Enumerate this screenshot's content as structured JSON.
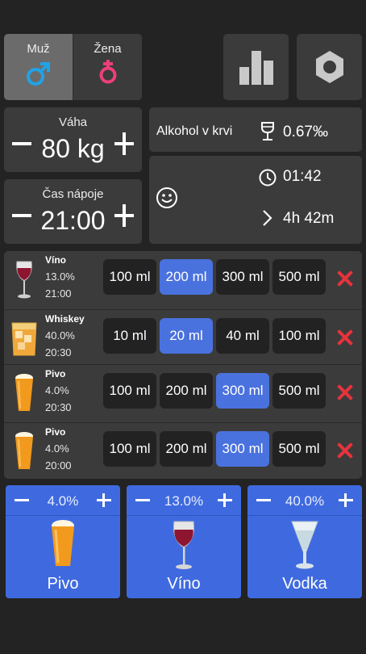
{
  "gender": {
    "male_label": "Muž",
    "female_label": "Žena",
    "selected": "male",
    "male_color": "#1fa3e8",
    "female_color": "#ec3f78"
  },
  "toolbar": {
    "stats_icon": "bar-chart-icon",
    "settings_icon": "hexagon-nut-icon"
  },
  "weight": {
    "label": "Váha",
    "value": "80 kg"
  },
  "drink_time": {
    "label": "Čas nápoje",
    "value": "21:00"
  },
  "bac": {
    "label": "Alkohol v krvi",
    "value": "0.67‰",
    "icon": "wine-glass-icon"
  },
  "status": {
    "mood_icon": "smiley-icon",
    "time_icon": "clock-icon",
    "time": "01:42",
    "remaining_icon": "chevron-right-icon",
    "remaining": "4h 42m"
  },
  "drinks": [
    {
      "name": "Víno",
      "percent": "13.0%",
      "time": "21:00",
      "icon": "wine-icon",
      "volumes": [
        "100 ml",
        "200 ml",
        "300 ml",
        "500 ml"
      ],
      "selected": 1
    },
    {
      "name": "Whiskey",
      "percent": "40.0%",
      "time": "20:30",
      "icon": "whiskey-icon",
      "volumes": [
        "10 ml",
        "20 ml",
        "40 ml",
        "100 ml"
      ],
      "selected": 1
    },
    {
      "name": "Pivo",
      "percent": "4.0%",
      "time": "20:30",
      "icon": "beer-icon",
      "volumes": [
        "100 ml",
        "200 ml",
        "300 ml",
        "500 ml"
      ],
      "selected": 2
    },
    {
      "name": "Pivo",
      "percent": "4.0%",
      "time": "20:00",
      "icon": "beer-icon",
      "volumes": [
        "100 ml",
        "200 ml",
        "300 ml",
        "500 ml"
      ],
      "selected": 2
    }
  ],
  "quick_add": [
    {
      "name": "Pivo",
      "percent": "4.0%",
      "icon": "beer-icon"
    },
    {
      "name": "Víno",
      "percent": "13.0%",
      "icon": "wine-icon"
    },
    {
      "name": "Vodka",
      "percent": "40.0%",
      "icon": "vodka-icon"
    }
  ],
  "colors": {
    "accent": "#3f6adf",
    "selected_volume": "#4a72de",
    "delete": "#e6333c",
    "card": "#3b3b3b",
    "background": "#232323"
  }
}
